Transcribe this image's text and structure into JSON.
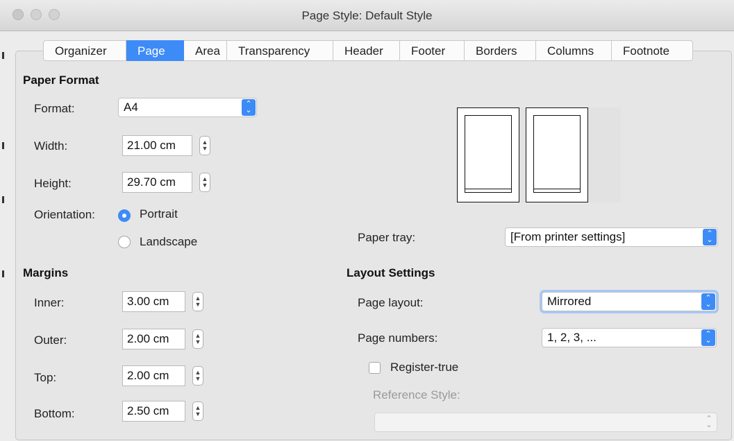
{
  "window": {
    "title": "Page Style: Default Style"
  },
  "tabs": [
    {
      "label": "Organizer",
      "active": false
    },
    {
      "label": "Page",
      "active": true
    },
    {
      "label": "Area",
      "active": false
    },
    {
      "label": "Transparency",
      "active": false
    },
    {
      "label": "Header",
      "active": false
    },
    {
      "label": "Footer",
      "active": false
    },
    {
      "label": "Borders",
      "active": false
    },
    {
      "label": "Columns",
      "active": false
    },
    {
      "label": "Footnote",
      "active": false
    }
  ],
  "paper_format": {
    "heading": "Paper Format",
    "format_label": "Format:",
    "format_value": "A4",
    "width_label": "Width:",
    "width_value": "21.00 cm",
    "height_label": "Height:",
    "height_value": "29.70 cm",
    "orientation_label": "Orientation:",
    "portrait_label": "Portrait",
    "landscape_label": "Landscape",
    "orientation_selected": "Portrait",
    "paper_tray_label": "Paper tray:",
    "paper_tray_value": "[From printer settings]"
  },
  "margins": {
    "heading": "Margins",
    "inner_label": "Inner:",
    "inner_value": "3.00 cm",
    "outer_label": "Outer:",
    "outer_value": "2.00 cm",
    "top_label": "Top:",
    "top_value": "2.00 cm",
    "bottom_label": "Bottom:",
    "bottom_value": "2.50 cm"
  },
  "layout_settings": {
    "heading": "Layout Settings",
    "page_layout_label": "Page layout:",
    "page_layout_value": "Mirrored",
    "page_numbers_label": "Page numbers:",
    "page_numbers_value": "1, 2, 3, ...",
    "register_true_label": "Register-true",
    "register_true_checked": false,
    "reference_style_label": "Reference Style:",
    "reference_style_value": ""
  },
  "colors": {
    "accent": "#3d8bf7"
  }
}
